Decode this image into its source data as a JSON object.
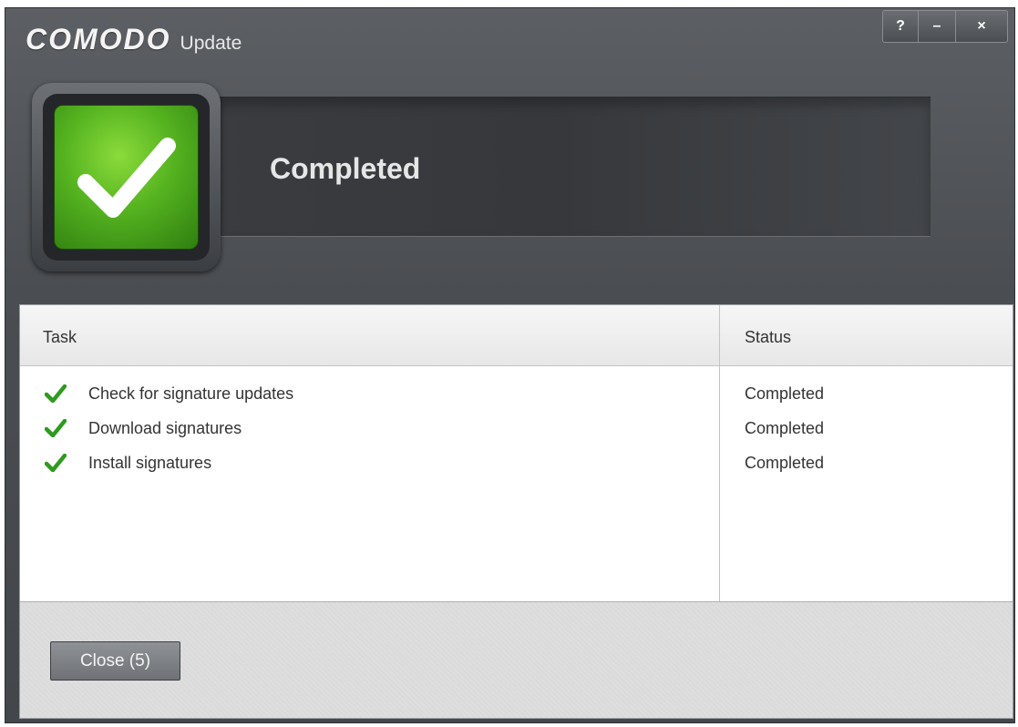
{
  "window": {
    "brand": "COMODO",
    "app_name": "Update",
    "controls": {
      "help": "?",
      "minimize": "–",
      "close": "×"
    }
  },
  "banner": {
    "status_icon": "checkmark-icon",
    "status_text": "Completed",
    "status_color": "#55b320"
  },
  "table": {
    "headers": {
      "task": "Task",
      "status": "Status"
    },
    "rows": [
      {
        "task": "Check for signature updates",
        "status": "Completed",
        "icon": "green-checkmark-icon"
      },
      {
        "task": "Download signatures",
        "status": "Completed",
        "icon": "green-checkmark-icon"
      },
      {
        "task": "Install signatures",
        "status": "Completed",
        "icon": "green-checkmark-icon"
      }
    ]
  },
  "footer": {
    "close_label": "Close (5)"
  },
  "colors": {
    "accent_green": "#2e9a1e"
  }
}
